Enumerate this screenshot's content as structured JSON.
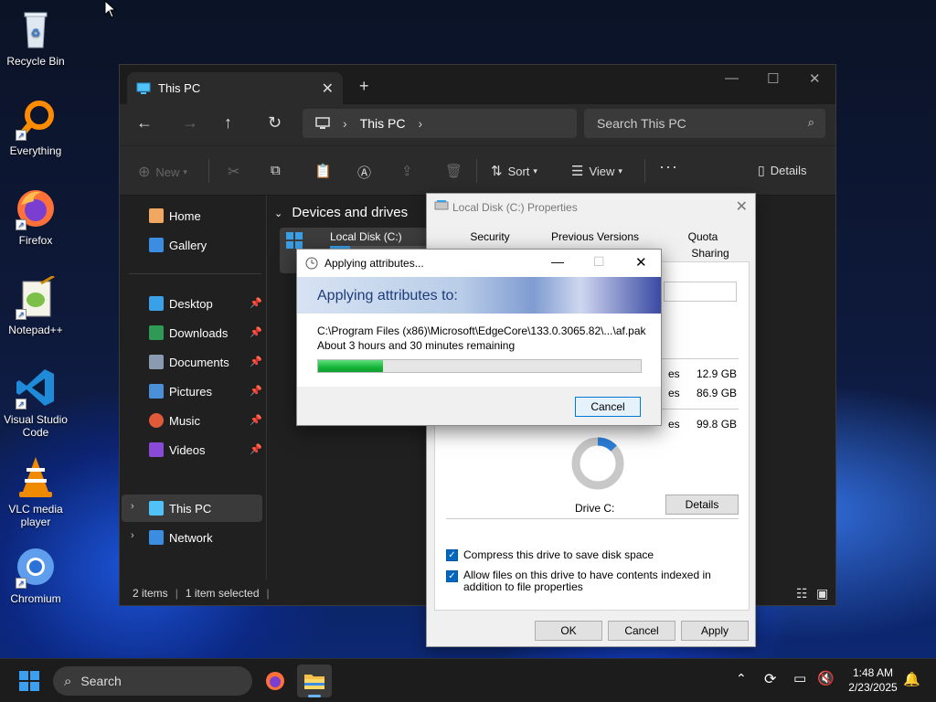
{
  "desktop": {
    "icons": [
      {
        "label": "Recycle Bin",
        "icon": "recycle-bin-icon"
      },
      {
        "label": "Everything",
        "icon": "everything-search-icon"
      },
      {
        "label": "Firefox",
        "icon": "firefox-icon"
      },
      {
        "label": "Notepad++",
        "icon": "notepadpp-icon"
      },
      {
        "label": "Visual Studio Code",
        "icon": "vscode-icon"
      },
      {
        "label": "VLC media player",
        "icon": "vlc-icon"
      },
      {
        "label": "Chromium",
        "icon": "chromium-icon"
      }
    ]
  },
  "explorer": {
    "tab_title": "This PC",
    "address": "This PC",
    "search_placeholder": "Search This PC",
    "toolbar": {
      "new": "New",
      "sort": "Sort",
      "view": "View",
      "more": "···",
      "details": "Details"
    },
    "sidebar": {
      "home": "Home",
      "gallery": "Gallery",
      "desktop": "Desktop",
      "downloads": "Downloads",
      "documents": "Documents",
      "pictures": "Pictures",
      "music": "Music",
      "videos": "Videos",
      "this_pc": "This PC",
      "network": "Network"
    },
    "group_header": "Devices and drives",
    "drive_name": "Local Disk (C:)",
    "status": {
      "items": "2 items",
      "selected": "1 item selected"
    }
  },
  "properties": {
    "title": "Local Disk (C:) Properties",
    "tabs": {
      "security": "Security",
      "previous_versions": "Previous Versions",
      "quota": "Quota",
      "sharing": "Sharing"
    },
    "sizes": {
      "used": "12.9 GB",
      "free": "86.9 GB",
      "capacity": "99.8 GB"
    },
    "used_fraction": 0.13,
    "drive_label": "Drive C:",
    "details_button": "Details",
    "compress_label": "Compress this drive to save disk space",
    "index_label": "Allow files on this drive to have contents indexed in addition to file properties",
    "ok": "OK",
    "cancel": "Cancel",
    "apply": "Apply"
  },
  "apply_dialog": {
    "title": "Applying attributes...",
    "header": "Applying attributes to:",
    "path": "C:\\Program Files (x86)\\Microsoft\\EdgeCore\\133.0.3065.82\\...\\af.pak",
    "remaining": "About 3 hours and 30 minutes remaining",
    "progress": 0.2,
    "cancel": "Cancel"
  },
  "taskbar": {
    "search_label": "Search",
    "time": "1:48 AM",
    "date": "2/23/2025"
  },
  "colors": {
    "accent": "#0067c0",
    "progress_green": "#16b53a",
    "explorer_bg": "#202020"
  }
}
